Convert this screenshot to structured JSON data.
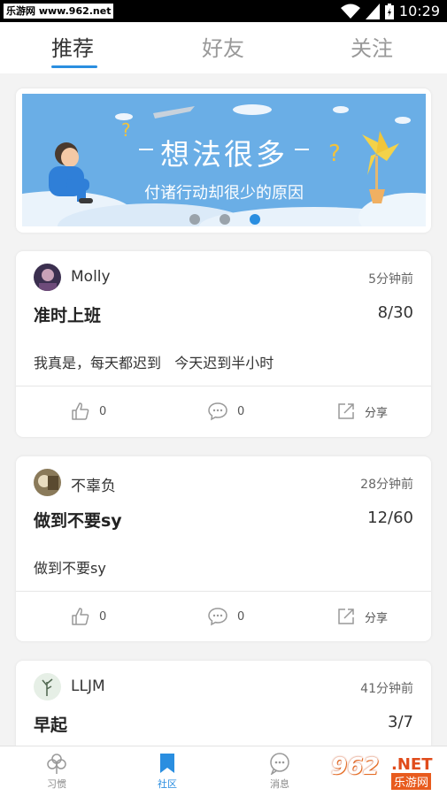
{
  "status_bar": {
    "watermark": "乐游网 www.962.net",
    "time": "10:29"
  },
  "tabs": [
    {
      "label": "推荐",
      "active": true
    },
    {
      "label": "好友",
      "active": false
    },
    {
      "label": "关注",
      "active": false
    }
  ],
  "banner": {
    "headline": "想法很多",
    "subline": "付诸行动却很少的原因",
    "slides": 3,
    "active_slide": 3
  },
  "posts": [
    {
      "user": "Molly",
      "time": "5分钟前",
      "title": "准时上班",
      "progress": "8/30",
      "body": "我真是，每天都迟到   今天迟到半小时",
      "likes": "0",
      "comments": "0",
      "share": "分享"
    },
    {
      "user": "不辜负",
      "time": "28分钟前",
      "title": "做到不要sy",
      "progress": "12/60",
      "body": "做到不要sy",
      "likes": "0",
      "comments": "0",
      "share": "分享"
    },
    {
      "user": "LLJM",
      "time": "41分钟前",
      "title": "早起",
      "progress": "3/7",
      "body": "",
      "likes": "",
      "comments": "",
      "share": ""
    }
  ],
  "bottom_nav": [
    {
      "label": "习惯",
      "icon": "clover-icon",
      "active": false
    },
    {
      "label": "社区",
      "icon": "bookmark-icon",
      "active": true
    },
    {
      "label": "消息",
      "icon": "chat-icon",
      "active": false
    }
  ],
  "watermark_brand": {
    "num": "962",
    "net": ".NET",
    "cn": "乐游网"
  },
  "colors": {
    "accent": "#2a8ee0",
    "banner_sky": "#6aaee6",
    "status_bar": "#000000"
  }
}
